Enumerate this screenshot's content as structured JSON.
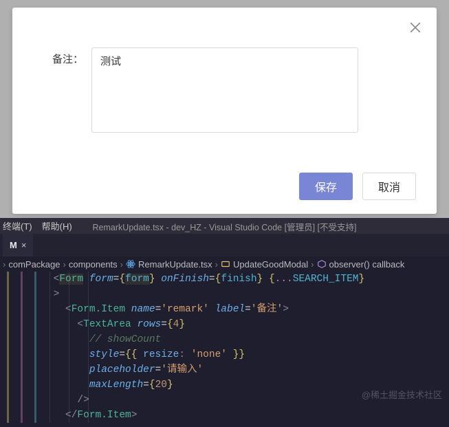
{
  "modal": {
    "form": {
      "remark_label": "备注：",
      "remark_value": "测试",
      "remark_placeholder": "请输入"
    },
    "buttons": {
      "save": "保存",
      "cancel": "取消"
    }
  },
  "editor": {
    "menu": {
      "terminal": "终端(T)",
      "help": "帮助(H)"
    },
    "title": "RemarkUpdate.tsx - dev_HZ - Visual Studio Code [管理员] [不受支持]",
    "tab": {
      "modified_indicator": "M",
      "close_glyph": "×"
    },
    "breadcrumbs": {
      "b1": "comPackage",
      "b2": "components",
      "b3": "RemarkUpdate.tsx",
      "b4": "UpdateGoodModal",
      "b5": "observer() callback"
    },
    "code": {
      "l0_a": "<",
      "l0_tag": "Form",
      "l0_b": " ",
      "l0_attr1": "form",
      "l0_eq": "=",
      "l0_br1": "{",
      "l0_v1": "form",
      "l0_br2": "}",
      "l0_sp": " ",
      "l0_attr2": "onFinish",
      "l0_eq2": "=",
      "l0_br3": "{",
      "l0_v2": "finish",
      "l0_br4": "}",
      "l0_sp2": " ",
      "l0_br5": "{",
      "l0_spread": "...",
      "l0_v3": "SEARCH_ITEM",
      "l0_br6": "}",
      "l1": ">",
      "l2_a": "<",
      "l2_tag": "Form.Item",
      "l2_sp1": " ",
      "l2_a1": "name",
      "l2_eq1": "=",
      "l2_v1": "'remark'",
      "l2_sp2": " ",
      "l2_a2": "label",
      "l2_eq2": "=",
      "l2_v2": "'备注'",
      "l2_e": ">",
      "l3_a": "<",
      "l3_tag": "TextArea",
      "l3_sp": " ",
      "l3_a1": "rows",
      "l3_eq": "=",
      "l3_b1": "{",
      "l3_v1": "4",
      "l3_b2": "}",
      "l4": "// showCount",
      "l5_a1": "style",
      "l5_eq": "=",
      "l5_b1": "{{",
      "l5_sp1": " ",
      "l5_p1": "resize",
      "l5_c": ":",
      "l5_sp2": " ",
      "l5_v1": "'none'",
      "l5_sp3": " ",
      "l5_b2": "}}",
      "l6_a1": "placeholder",
      "l6_eq": "=",
      "l6_v1": "'请输入'",
      "l7_a1": "maxLength",
      "l7_eq": "=",
      "l7_b1": "{",
      "l7_v1": "20",
      "l7_b2": "}",
      "l8": "/>",
      "l9_a": "</",
      "l9_tag": "Form.Item",
      "l9_e": ">"
    },
    "watermark": "@稀土掘金技术社区"
  }
}
